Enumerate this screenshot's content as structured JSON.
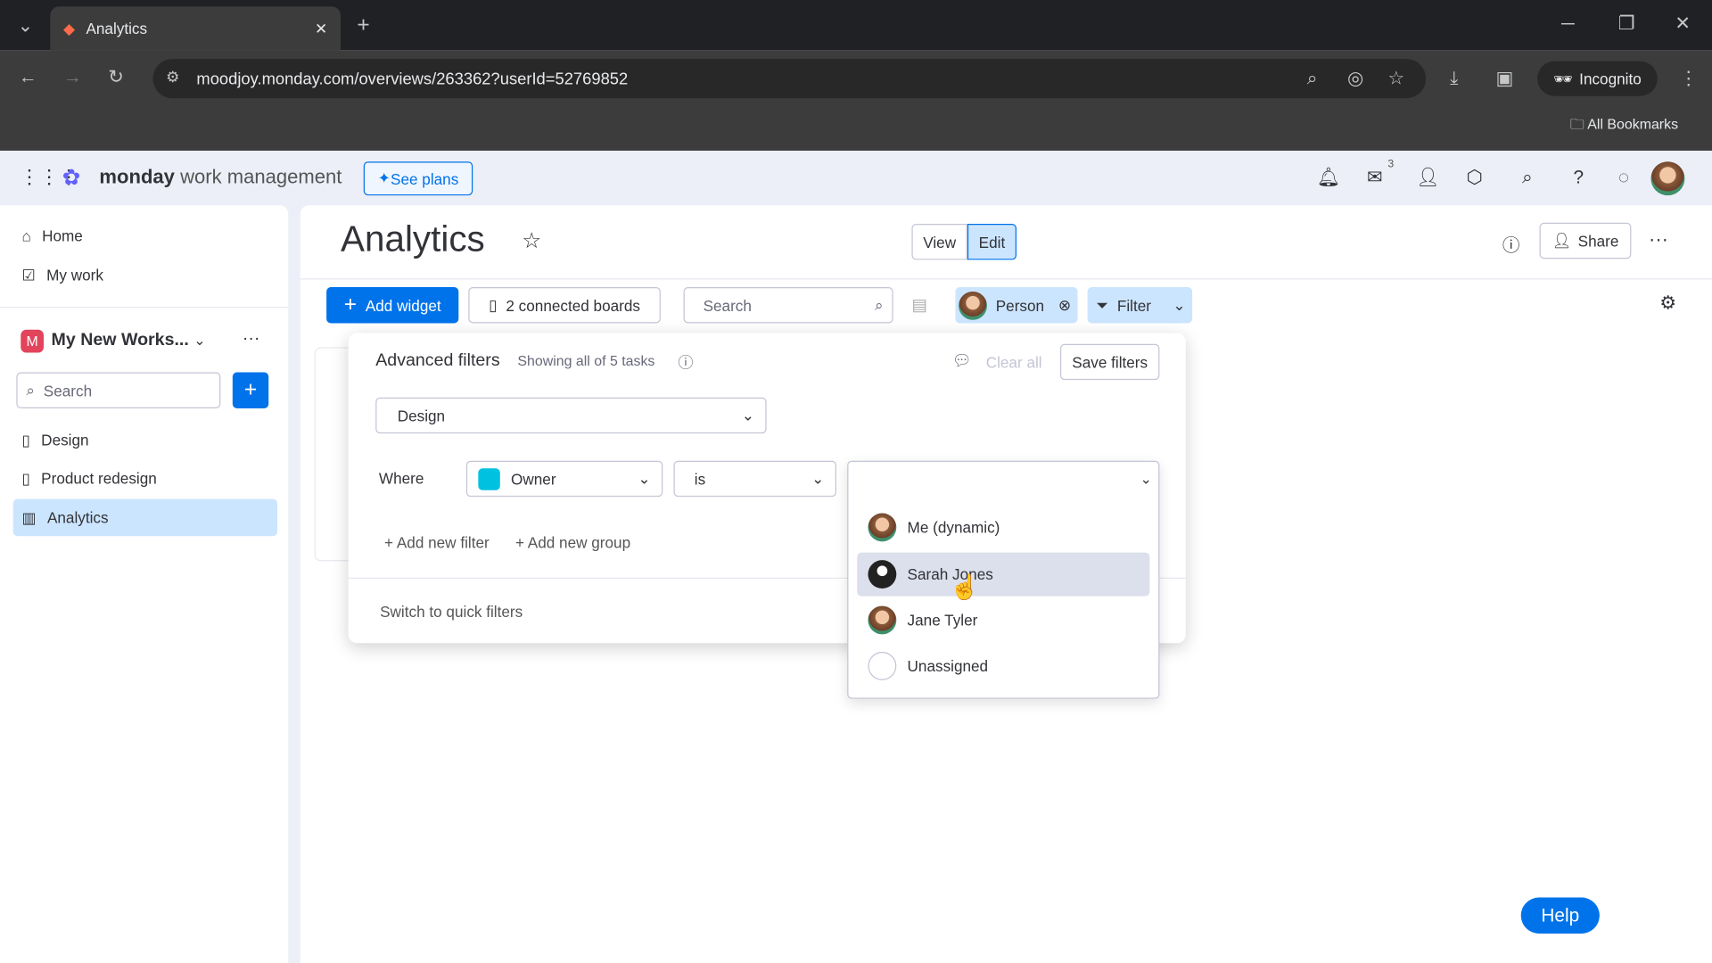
{
  "browser": {
    "tab_title": "Analytics",
    "url": "moodjoy.monday.com/overviews/263362?userId=52769852",
    "incognito_label": "Incognito",
    "bookmarks_label": "All Bookmarks"
  },
  "app": {
    "brand": "monday",
    "brand_sub": "work management",
    "see_plans": "See plans",
    "inbox_badge": "3"
  },
  "sidebar": {
    "items": [
      {
        "label": "Home"
      },
      {
        "label": "My work"
      }
    ],
    "workspace": "My New Works...",
    "search_placeholder": "Search",
    "boards": [
      {
        "label": "Design"
      },
      {
        "label": "Product redesign"
      },
      {
        "label": "Analytics"
      }
    ]
  },
  "header": {
    "title": "Analytics",
    "view": "View",
    "edit": "Edit",
    "share": "Share"
  },
  "toolbar": {
    "add_widget": "Add widget",
    "connected_boards": "2 connected boards",
    "search_placeholder": "Search",
    "person": "Person",
    "filter": "Filter"
  },
  "filters": {
    "title": "Advanced filters",
    "showing": "Showing all of 5 tasks",
    "clear_all": "Clear all",
    "save": "Save filters",
    "board": "Design",
    "where": "Where",
    "column": "Owner",
    "condition": "is",
    "add_filter": "+ Add new filter",
    "add_group": "+ Add new group",
    "switch": "Switch to quick filters",
    "options": [
      {
        "label": "Me (dynamic)"
      },
      {
        "label": "Sarah Jones"
      },
      {
        "label": "Jane Tyler"
      },
      {
        "label": "Unassigned"
      }
    ]
  },
  "help": "Help",
  "colors": {
    "primary": "#0073ea",
    "selected": "#cce5ff",
    "hover": "#dcdfec"
  }
}
